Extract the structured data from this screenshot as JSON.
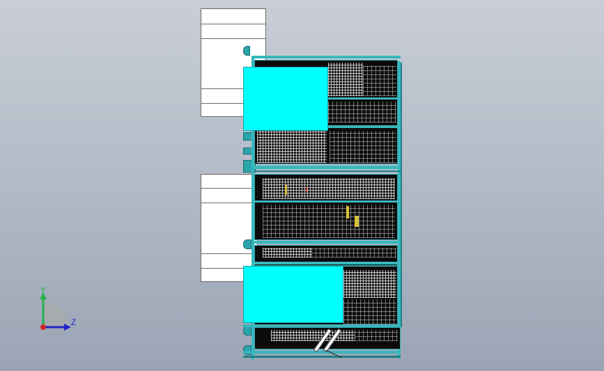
{
  "view": {
    "background_top": "#c9ced6",
    "background_bottom": "#9aa4b4",
    "accent_cyan": "#00ffff",
    "frame_teal": "#39b7bd"
  },
  "triad": {
    "y_label": "Y",
    "z_label": "Z",
    "y_color": "#22b14c",
    "z_color": "#2323c8",
    "origin_color": "#d4232a"
  }
}
